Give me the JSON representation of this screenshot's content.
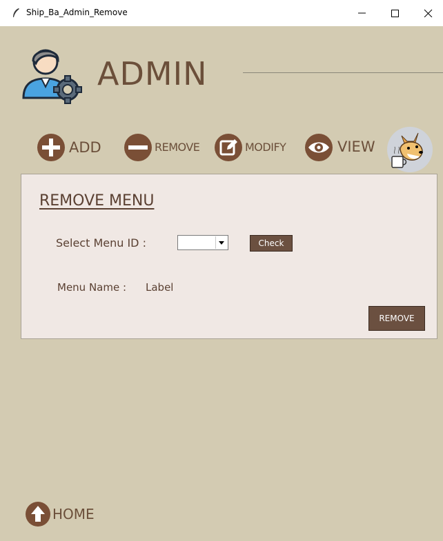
{
  "window": {
    "title": "Ship_Ba_Admin_Remove"
  },
  "header": {
    "title": "ADMIN"
  },
  "nav": {
    "add": "ADD",
    "remove": "REMOVE",
    "modify": "MODIFY",
    "view": "VIEW"
  },
  "panel": {
    "title": "REMOVE MENU",
    "select_label": "Select Menu ID  :",
    "select_value": "",
    "check_button": "Check",
    "name_label": "Menu Name  :",
    "name_value": "Label",
    "remove_button": "REMOVE"
  },
  "footer": {
    "home": "HOME"
  },
  "colors": {
    "background": "#d3cbb2",
    "panel": "#f0e8e4",
    "brown": "#7a4f36",
    "button": "#6b5040",
    "text": "#5a4032"
  },
  "icons": [
    "feather-icon",
    "admin-gear-icon",
    "plus-icon",
    "minus-icon",
    "edit-icon",
    "eye-icon",
    "doge-coffee-icon",
    "up-arrow-icon"
  ]
}
